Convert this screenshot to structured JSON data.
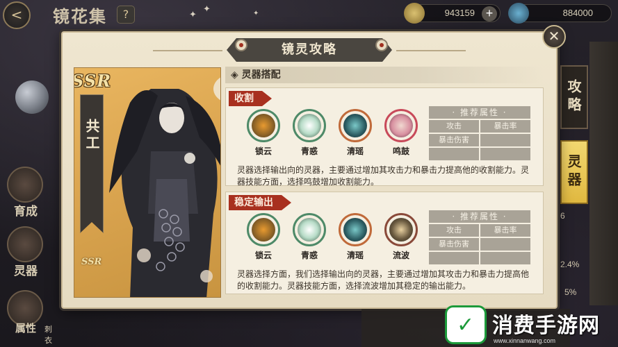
{
  "background": {
    "title": "镜花集",
    "help_label": "?",
    "back_label": "<",
    "currency": [
      {
        "value": "943159"
      },
      {
        "value": "884000"
      }
    ],
    "plus_label": "+",
    "side_menu": [
      "育成",
      "灵器",
      "属性"
    ],
    "side_extra": "刺衣",
    "right_tabs": {
      "strategy": "攻略",
      "spirit": "灵器"
    },
    "right_values": [
      "2.4%",
      "5%",
      "6"
    ]
  },
  "modal": {
    "title": "镜灵攻略",
    "close_label": "✕",
    "character": {
      "rarity": "SSR",
      "name": "共工"
    },
    "section_header": "◈ 灵器搭配",
    "attr_header": "· 推荐属性 ·",
    "attr_cells": [
      [
        "攻击",
        "暴击率"
      ],
      [
        "暴击伤害",
        ""
      ],
      [
        "",
        ""
      ]
    ],
    "sections": [
      {
        "tag": "收割",
        "spirits": [
          "锁云",
          "青惑",
          "清瑶",
          "鸣鼓"
        ],
        "description": "灵器选择输出向的灵器，主要通过增加其攻击力和暴击力提高他的收割能力。灵器技能方面，选择鸣鼓增加收割能力。"
      },
      {
        "tag": "稳定输出",
        "spirits": [
          "锁云",
          "青惑",
          "清瑶",
          "流波"
        ],
        "description": "灵器选择方面，我们选择输出向的灵器，主要通过增加其攻击力和暴击力提高他的收割能力。灵器技能方面，选择流波增加其稳定的输出能力。"
      }
    ]
  },
  "watermark": {
    "text": "消费手游网",
    "url": "www.xinnanwang.com"
  },
  "colors": {
    "accent_red": "#a8301f",
    "panel_bg": "#efe6d0",
    "tab_gold": "#f2d770"
  }
}
